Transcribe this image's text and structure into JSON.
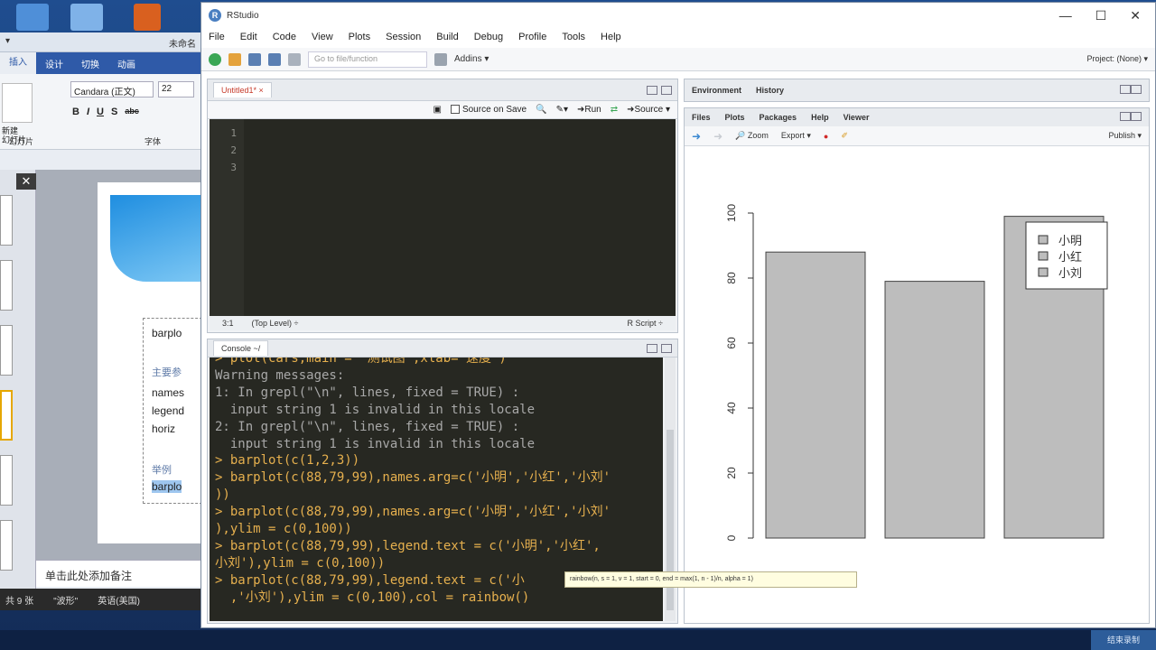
{
  "desktop": {
    "colors": {
      "blue": "#1f4d8f"
    }
  },
  "ppt": {
    "title_right": "未命名",
    "tabs": [
      "插入",
      "设计",
      "切换",
      "动画"
    ],
    "font_name": "Candara (正文)",
    "font_size": "22",
    "format_buttons": [
      "B",
      "I",
      "U",
      "S",
      "abc"
    ],
    "group_slides": "幻灯片",
    "group_font": "字体",
    "new_slide_label": "新建\n幻灯片",
    "slide_lines": [
      "barplo",
      "主要参",
      "names",
      "legend",
      "horiz",
      "举例",
      "barplo"
    ],
    "notes_placeholder": "单击此处添加备注",
    "status": [
      "共 9 张",
      "\"波形\"",
      "英语(美国)"
    ]
  },
  "rstudio": {
    "title": "RStudio",
    "window_buttons": [
      "—",
      "☐",
      "✕"
    ],
    "menu": [
      "File",
      "Edit",
      "Code",
      "View",
      "Plots",
      "Session",
      "Build",
      "Debug",
      "Profile",
      "Tools",
      "Help"
    ],
    "toolbar": {
      "goto_placeholder": "Go to file/function",
      "addins": "Addins ▾",
      "project": "Project: (None) ▾"
    },
    "source": {
      "tab": "Untitled1* ×",
      "source_on_save": "Source on Save",
      "run": "Run",
      "source_btn": "Source ▾",
      "line_numbers": [
        "1",
        "2",
        "3"
      ],
      "status_pos": "3:1",
      "status_level": "(Top Level) ÷",
      "status_type": "R Script ÷"
    },
    "console": {
      "tab": "Console ~/",
      "lines": [
        {
          "kind": "cmd",
          "text": "> plot(cars,main = '测试图',xlab='速度')"
        },
        {
          "kind": "out",
          "text": "Warning messages:"
        },
        {
          "kind": "out",
          "text": "1: In grepl(\"\\n\", lines, fixed = TRUE) :"
        },
        {
          "kind": "out",
          "text": "  input string 1 is invalid in this locale"
        },
        {
          "kind": "out",
          "text": "2: In grepl(\"\\n\", lines, fixed = TRUE) :"
        },
        {
          "kind": "out",
          "text": "  input string 1 is invalid in this locale"
        },
        {
          "kind": "cmd",
          "text": "> barplot(c(1,2,3))"
        },
        {
          "kind": "cmd",
          "text": "> barplot(c(88,79,99),names.arg=c('小明','小红','小刘'"
        },
        {
          "kind": "cmd",
          "text": "))"
        },
        {
          "kind": "cmd",
          "text": "> barplot(c(88,79,99),names.arg=c('小明','小红','小刘'"
        },
        {
          "kind": "cmd",
          "text": "),ylim = c(0,100))"
        },
        {
          "kind": "cmd",
          "text": "> barplot(c(88,79,99),legend.text = c('小明','小红',"
        },
        {
          "kind": "cmd",
          "text": "小刘'),ylim = c(0,100))"
        },
        {
          "kind": "cmd",
          "text": "> barplot(c(88,79,99),legend.text = c('小"
        },
        {
          "kind": "cmd",
          "text": "  ,'小刘'),ylim = c(0,100),col = rainbow()"
        }
      ],
      "tooltip": "rainbow(n, s = 1, v = 1, start = 0, end = max(1, n - 1)/n, alpha = 1)"
    },
    "env": {
      "tabs": [
        "Environment",
        "History"
      ]
    },
    "plots": {
      "tabs": [
        "Files",
        "Plots",
        "Packages",
        "Help",
        "Viewer"
      ],
      "zoom": "Zoom",
      "export": "Export ▾",
      "publish": "Publish ▾"
    }
  },
  "taskbar": {
    "record_label": "结束录制"
  },
  "chart_data": {
    "type": "bar",
    "categories": [
      "",
      "",
      ""
    ],
    "values": [
      88,
      79,
      99
    ],
    "series": [
      {
        "values": [
          88,
          79,
          99
        ]
      }
    ],
    "legend": [
      "小明",
      "小红",
      "小刘"
    ],
    "legend_position": "top-right",
    "ylim": [
      0,
      100
    ],
    "yticks": [
      0,
      20,
      40,
      60,
      80,
      100
    ],
    "bar_color": "#bdbdbd",
    "grid": false
  }
}
